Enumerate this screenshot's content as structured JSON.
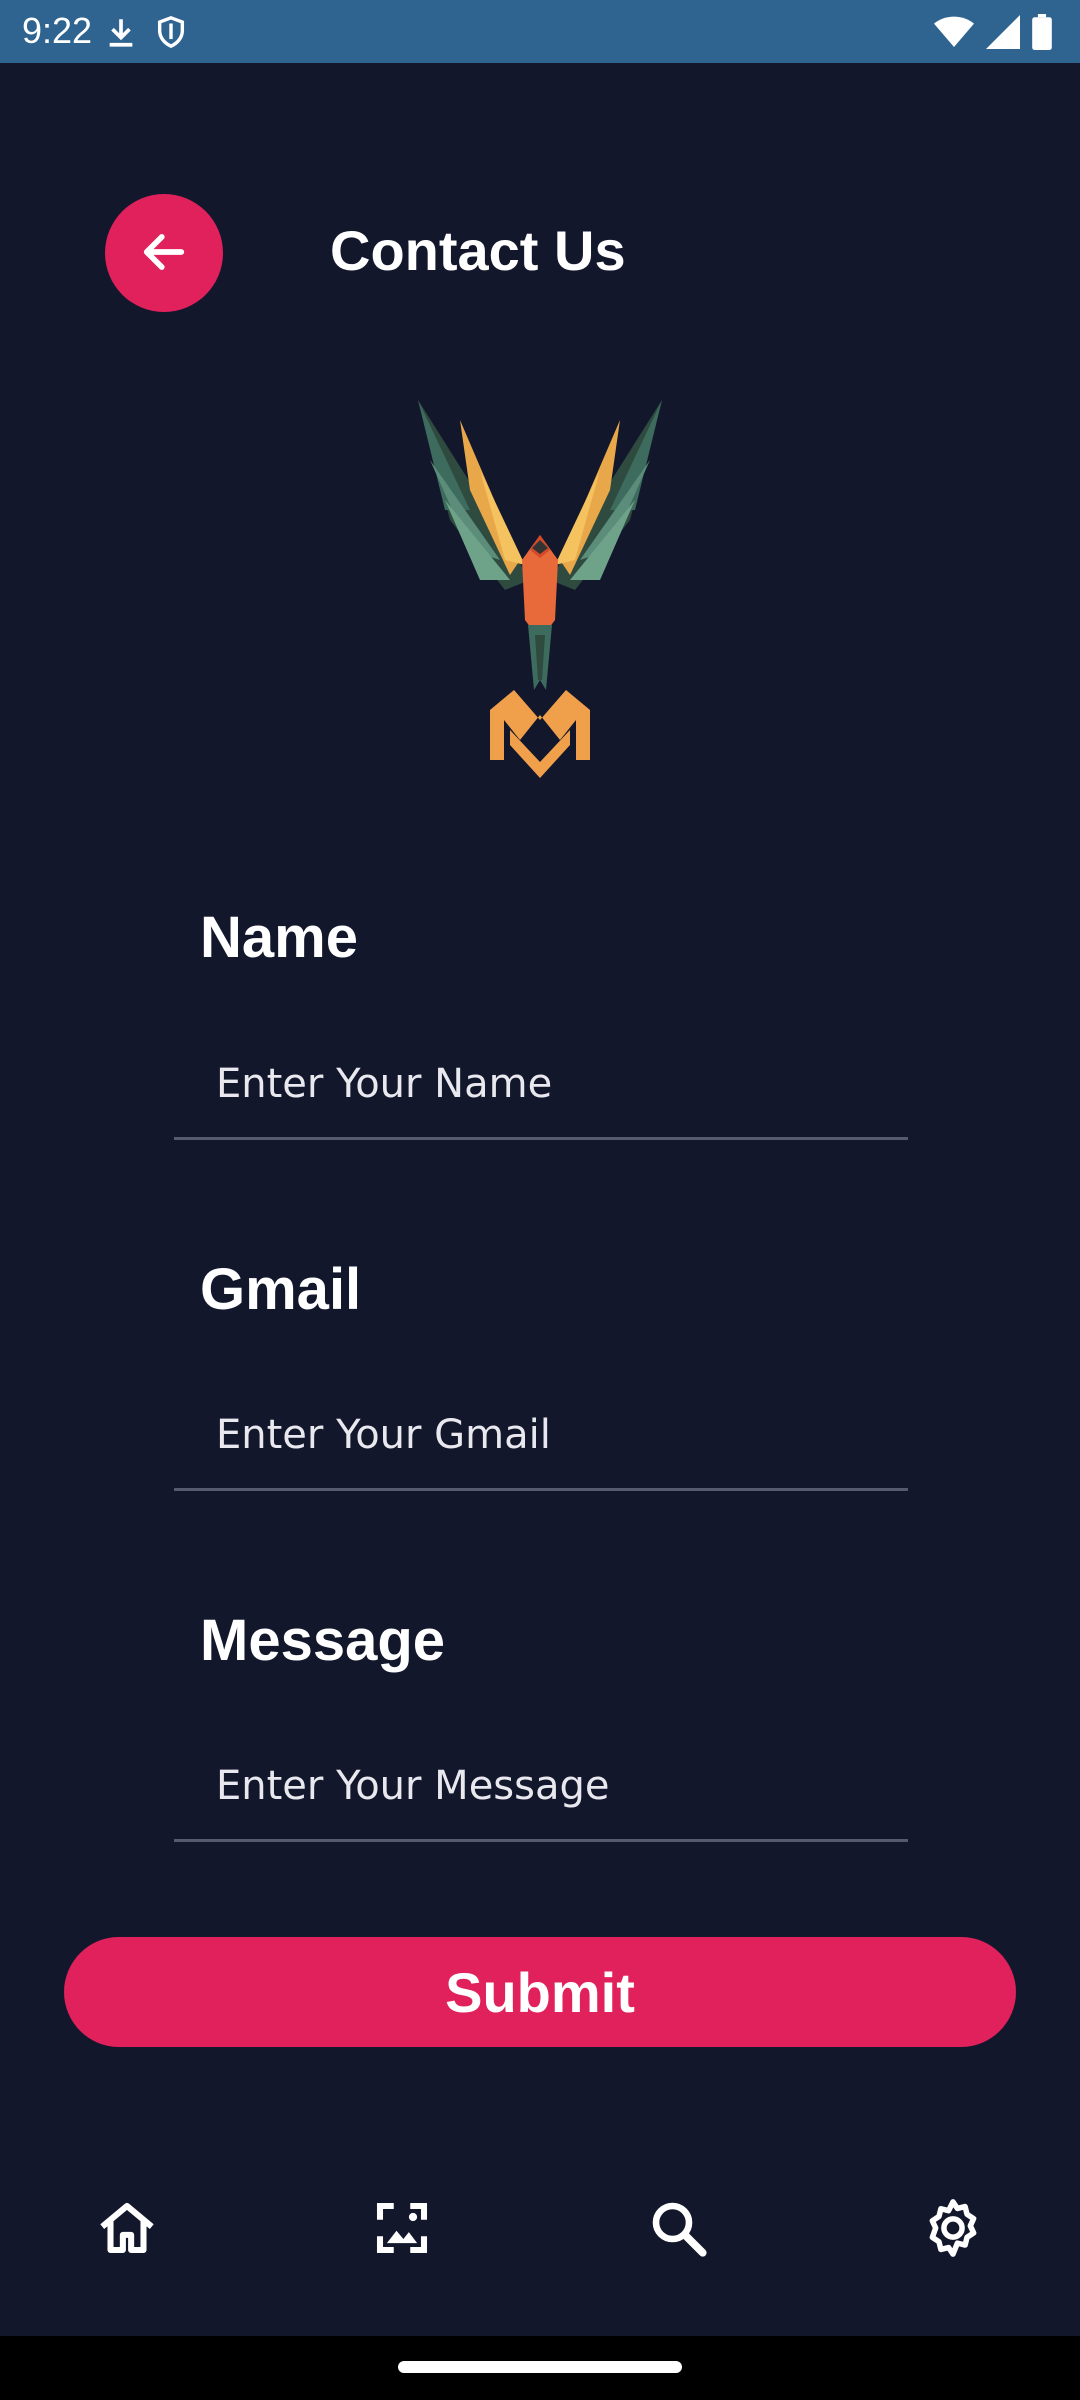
{
  "status_bar": {
    "time": "9:22",
    "icons": [
      "download-icon",
      "shield-icon",
      "wifi-icon",
      "signal-icon",
      "battery-icon"
    ],
    "background": "#2f6491"
  },
  "header": {
    "title": "Contact Us",
    "back_icon": "arrow-left-icon"
  },
  "form": {
    "name": {
      "label": "Name",
      "value": "",
      "placeholder": "Enter Your Name"
    },
    "gmail": {
      "label": "Gmail",
      "value": "",
      "placeholder": "Enter Your Gmail"
    },
    "message": {
      "label": "Message",
      "value": "",
      "placeholder": "Enter Your Message"
    },
    "submit_label": "Submit"
  },
  "bottom_nav": {
    "items": [
      {
        "icon": "home-icon"
      },
      {
        "icon": "gallery-icon"
      },
      {
        "icon": "search-icon"
      },
      {
        "icon": "settings-icon"
      }
    ]
  },
  "colors": {
    "background": "#13172c",
    "accent": "#e0215b",
    "logo_orange": "#f0a04b"
  }
}
